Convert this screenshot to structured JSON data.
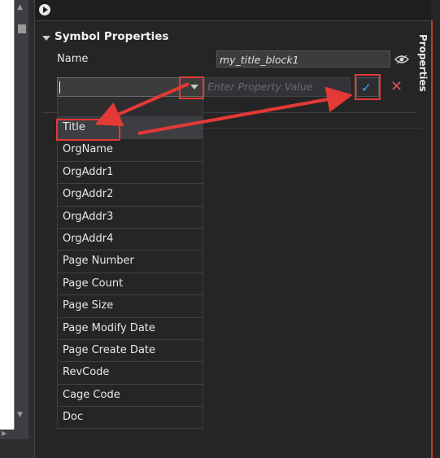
{
  "panel": {
    "section_title": "Symbol Properties",
    "name_label": "Name",
    "name_value": "my_title_block1",
    "combo_value": "",
    "value_placeholder": "Enter Property Value",
    "right_tab_label": "Properties"
  },
  "dropdown": {
    "items": [
      "Title",
      "OrgName",
      "OrgAddr1",
      "OrgAddr2",
      "OrgAddr3",
      "OrgAddr4",
      "Page Number",
      "Page Count",
      "Page Size",
      "Page Modify Date",
      "Page Create Date",
      "RevCode",
      "Cage Code",
      "Doc"
    ],
    "selected": "Title"
  },
  "icons": {
    "collapse": "chevron-down-icon",
    "visibility": "eye-icon",
    "confirm": "checkmark-icon",
    "cancel": "close-icon"
  },
  "colors": {
    "annotation": "#e53935",
    "confirm_check": "#4ea3ff",
    "cancel_x": "#e05050",
    "background": "#252526"
  }
}
